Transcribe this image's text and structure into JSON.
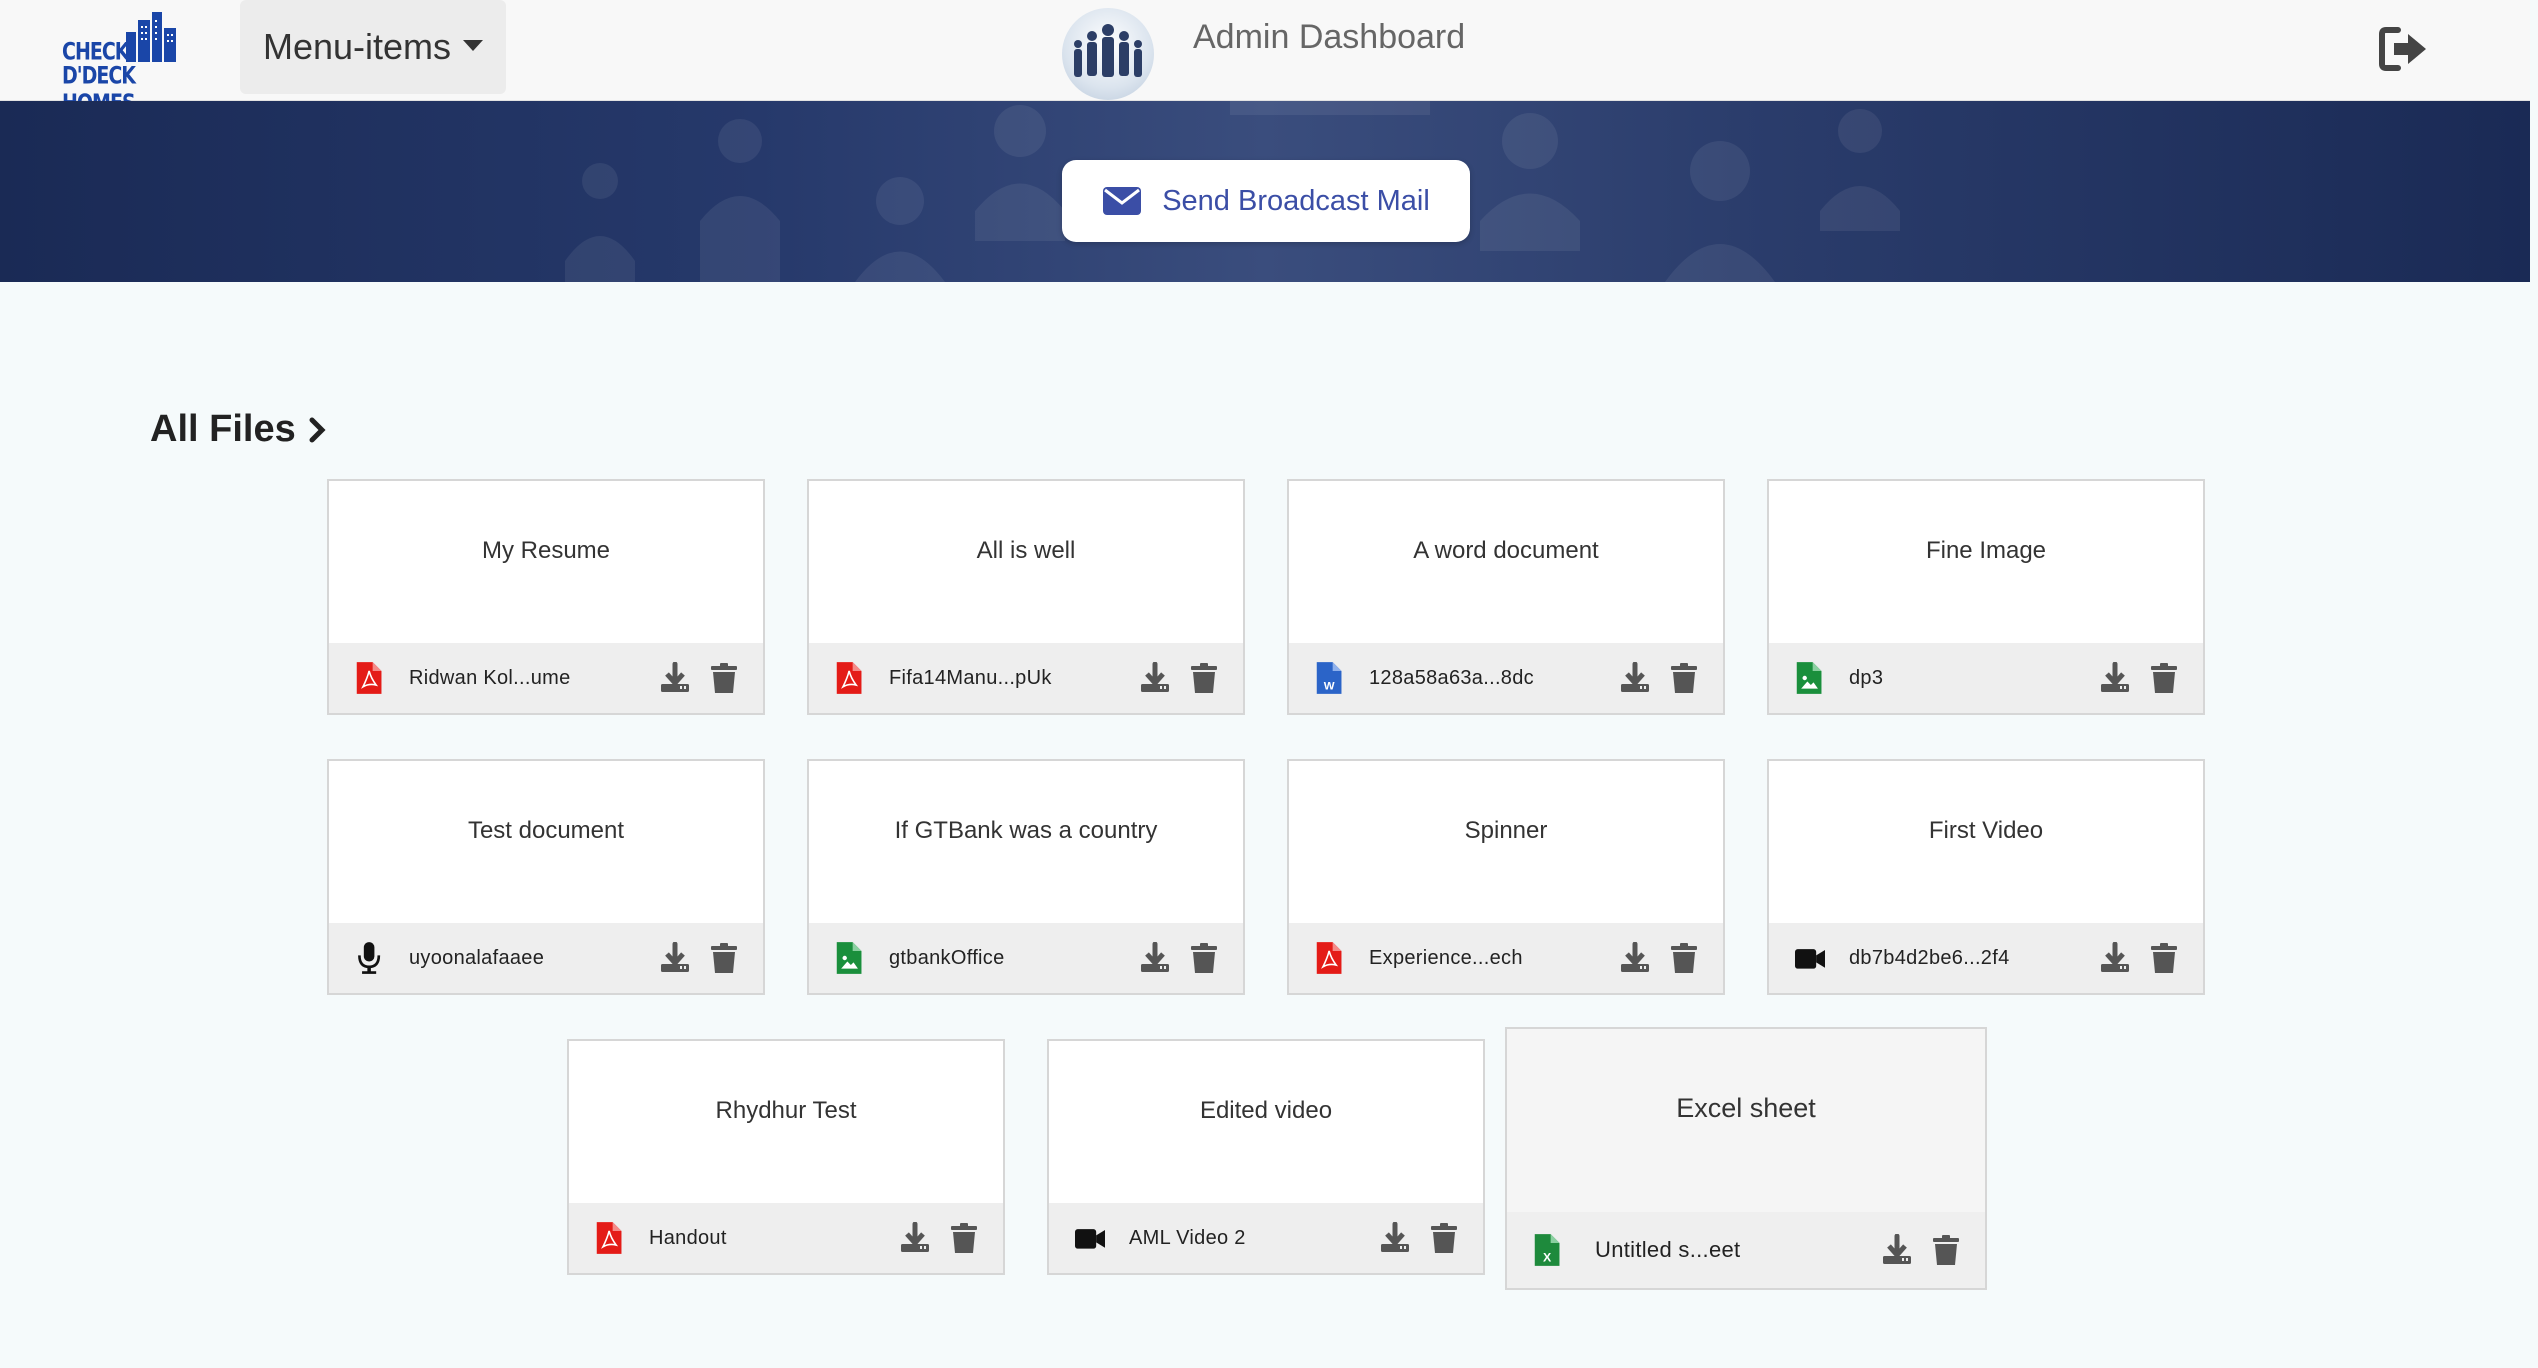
{
  "header": {
    "logo_line1": "CHECK",
    "logo_line2": "D'DECK HOMES",
    "menu_label": "Menu-items",
    "title": "Admin Dashboard",
    "logout_icon": "sign-out-icon"
  },
  "banner": {
    "button_label": "Send Broadcast Mail",
    "button_icon": "envelope-icon"
  },
  "section": {
    "title": "All Files",
    "icon": "chevron-right-icon"
  },
  "colors": {
    "brand_blue": "#1a46a8",
    "banner_navy": "#1f3160",
    "button_text": "#3b4ea6",
    "pdf_red": "#e41b17",
    "image_green": "#1a8f3c",
    "word_blue": "#2b64c8",
    "excel_green": "#1e8a3c"
  },
  "files": [
    {
      "title": "My Resume",
      "filename": "Ridwan Kol...ume",
      "type": "pdf"
    },
    {
      "title": "All is well",
      "filename": "Fifa14Manu...pUk",
      "type": "pdf"
    },
    {
      "title": "A word document",
      "filename": "128a58a63a...8dc",
      "type": "word"
    },
    {
      "title": "Fine Image",
      "filename": "dp3",
      "type": "image"
    },
    {
      "title": "Test document",
      "filename": "uyoonalafaaee",
      "type": "audio"
    },
    {
      "title": "If GTBank was a country",
      "filename": "gtbankOffice",
      "type": "image"
    },
    {
      "title": "Spinner",
      "filename": "Experience...ech",
      "type": "pdf"
    },
    {
      "title": "First Video",
      "filename": "db7b4d2be6...2f4",
      "type": "video"
    },
    {
      "title": "Rhydhur Test",
      "filename": "Handout",
      "type": "pdf"
    },
    {
      "title": "Edited video",
      "filename": "AML Video 2",
      "type": "video"
    },
    {
      "title": "Excel sheet",
      "filename": "Untitled s...eet",
      "type": "excel"
    }
  ]
}
